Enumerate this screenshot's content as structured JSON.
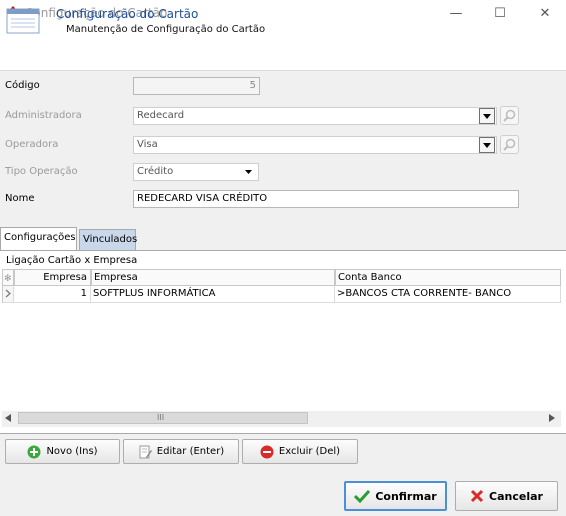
{
  "window": {
    "title": "Configuração do Cartão",
    "minimize_glyph": "—",
    "maximize_glyph": "☐",
    "close_glyph": "✕"
  },
  "header": {
    "title": "Configuração do Cartão",
    "subtitle": "Manutenção de Configuração do Cartão"
  },
  "form": {
    "codigo": {
      "label": "Código",
      "value": "5"
    },
    "administradora": {
      "label": "Administradora",
      "value": "Redecard"
    },
    "operadora": {
      "label": "Operadora",
      "value": "Visa"
    },
    "tipo_operacao": {
      "label": "Tipo Operação",
      "value": "Crédito"
    },
    "nome": {
      "label": "Nome",
      "value": "REDECARD VISA CRÉDITO"
    }
  },
  "tabs": [
    {
      "label": "Configurações",
      "active": true
    },
    {
      "label": "Vinculados",
      "active": false
    }
  ],
  "grid": {
    "caption": "Ligação Cartão x Empresa",
    "columns": [
      "Empresa",
      "Empresa",
      "Conta Banco"
    ],
    "rows": [
      {
        "empresa_id": "1",
        "empresa": "SOFTPLUS INFORMÁTICA",
        "conta_banco": ">BANCOS CTA CORRENTE- BANCO"
      }
    ],
    "scroll_thumb_glyph": "III"
  },
  "actions": {
    "novo": "Novo (Ins)",
    "editar": "Editar (Enter)",
    "excluir": "Excluir (Del)"
  },
  "footer": {
    "confirmar": "Confirmar",
    "cancelar": "Cancelar"
  },
  "colors": {
    "header_title": "#1e4fa0",
    "inactive_tab": "#c9d7ea",
    "focus_border": "#4a90d9"
  }
}
